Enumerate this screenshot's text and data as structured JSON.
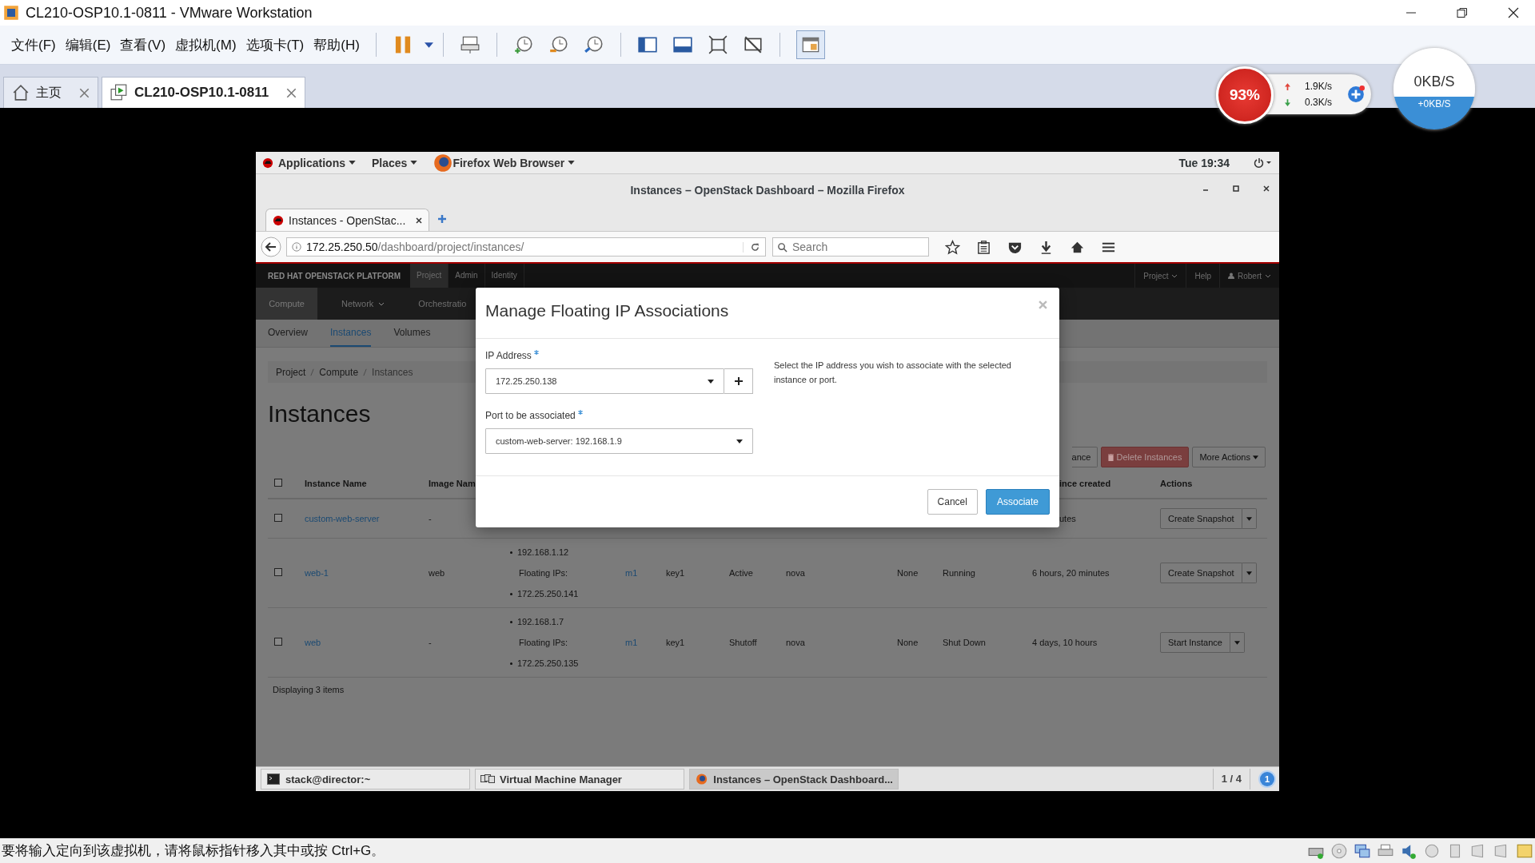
{
  "window": {
    "title": "CL210-OSP10.1-0811 - VMware Workstation"
  },
  "menu": [
    "文件(F)",
    "编辑(E)",
    "查看(V)",
    "虚拟机(M)",
    "选项卡(T)",
    "帮助(H)"
  ],
  "tabs": [
    {
      "label": "主页",
      "selected": false,
      "kind": "home"
    },
    {
      "label": "CL210-OSP10.1-0811",
      "selected": true,
      "kind": "vm"
    }
  ],
  "network_monitor": {
    "cpu": "93%",
    "upload": "1.9K/s",
    "download": "0.3K/s",
    "speed": "0KB/S",
    "speed_delta": "+0KB/S"
  },
  "guest": {
    "top_bar": {
      "menus": [
        "Applications",
        "Places",
        "Firefox Web Browser"
      ],
      "clock": "Tue 19:34"
    },
    "browser": {
      "title": "Instances – OpenStack Dashboard – Mozilla Firefox",
      "tab": "Instances - OpenStac...",
      "url_host": "172.25.250.50",
      "url_path": "/dashboard/project/instances/",
      "search_placeholder": "Search"
    },
    "dashboard": {
      "brand": "RED HAT OPENSTACK PLATFORM",
      "top_nav": [
        {
          "label": "Project",
          "selected": true
        },
        {
          "label": "Admin",
          "selected": false
        },
        {
          "label": "Identity",
          "selected": false
        }
      ],
      "right_nav": [
        "Project",
        "Help",
        "Robert"
      ],
      "sections": [
        {
          "label": "Compute",
          "selected": true
        },
        {
          "label": "Network",
          "selected": false
        },
        {
          "label": "Orchestratio",
          "selected": false
        }
      ],
      "subnav": [
        {
          "label": "Overview",
          "selected": false
        },
        {
          "label": "Instances",
          "selected": true
        },
        {
          "label": "Volumes",
          "selected": false
        }
      ],
      "breadcrumb": [
        "Project",
        "Compute",
        "Instances"
      ],
      "heading": "Instances",
      "actions": [
        {
          "label": "ance",
          "kind": "partial"
        },
        {
          "label": "Delete Instances",
          "kind": "danger"
        },
        {
          "label": "More Actions",
          "kind": "dropdown"
        }
      ],
      "header": {
        "checked": false,
        "columns": [
          "Instance Name",
          "Image Nam",
          "ince created",
          "Actions"
        ]
      },
      "rows": [
        {
          "checked": false,
          "name": "custom-web-server",
          "image": "-",
          "age": "utes",
          "action": "Create Snapshot"
        },
        {
          "checked": false,
          "name": "web-1",
          "image": "web",
          "fixed_ip": "192.168.1.12",
          "floating_label": "Floating IPs:",
          "floating_ip": "172.25.250.141",
          "flavor": "m1",
          "key": "key1",
          "status": "Active",
          "zone": "nova",
          "task": "None",
          "power": "Running",
          "age": "6 hours, 20 minutes",
          "action": "Create Snapshot"
        },
        {
          "checked": false,
          "name": "web",
          "image": "-",
          "fixed_ip": "192.168.1.7",
          "floating_label": "Floating IPs:",
          "floating_ip": "172.25.250.135",
          "flavor": "m1",
          "key": "key1",
          "status": "Shutoff",
          "zone": "nova",
          "task": "None",
          "power": "Shut Down",
          "age": "4 days, 10 hours",
          "action": "Start Instance"
        }
      ],
      "footer": "Displaying 3 items"
    },
    "modal": {
      "title": "Manage Floating IP Associations",
      "ip_label": "IP Address",
      "ip_value": "172.25.250.138",
      "port_label": "Port to be associated",
      "port_value": "custom-web-server: 192.168.1.9",
      "help": "Select the IP address you wish to associate with the selected instance or port.",
      "cancel": "Cancel",
      "submit": "Associate"
    },
    "taskbar": {
      "items": [
        {
          "label": "stack@director:~",
          "selected": false,
          "kind": "terminal"
        },
        {
          "label": "Virtual Machine Manager",
          "selected": false,
          "kind": "vmm"
        },
        {
          "label": "Instances – OpenStack Dashboard...",
          "selected": true,
          "kind": "browser"
        }
      ],
      "workspace": "1 / 4",
      "notification_count": "1"
    }
  },
  "status_bar": {
    "message": "要将输入定向到该虚拟机，请将鼠标指针移入其中或按 Ctrl+G。"
  }
}
